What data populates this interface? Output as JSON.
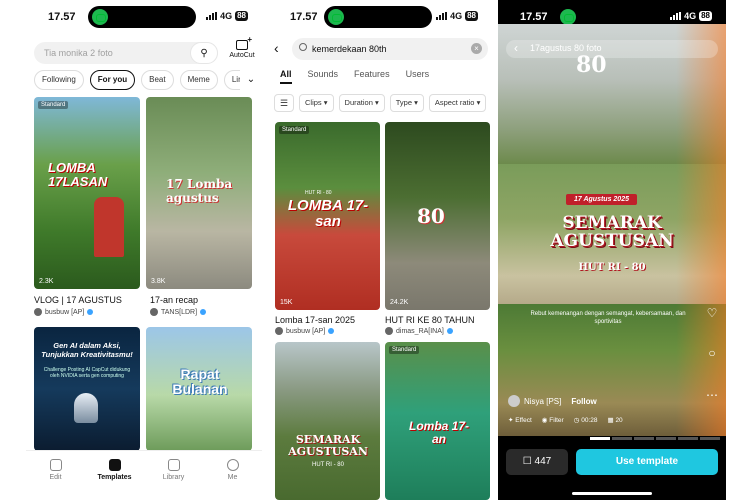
{
  "screen1": {
    "time": "17.57",
    "network": "4G",
    "battery": "88",
    "search_placeholder": "Tia monika 2 foto",
    "autocut_label": "AutoCut",
    "chips": [
      "Following",
      "For you",
      "Beat",
      "Meme",
      "Lirik V"
    ],
    "active_chip": "For you",
    "cards": [
      {
        "tag": "Standard",
        "likes": "2.3K",
        "title": "VLOG | 17 AGUSTUS",
        "author": "busbuw [AP]",
        "overlay": "LOMBA 17LASAN"
      },
      {
        "tag": "",
        "likes": "3.8K",
        "title": "17-an recap",
        "author": "TANS[LDR]",
        "overlay": "17 Lomba agustus"
      },
      {
        "tag": "",
        "likes": "",
        "title": "",
        "author": "",
        "overlay_head": "Gen AI dalam Aksi, Tunjukkan Kreativitasmu!",
        "overlay_sub": "Challenge Posting AI CapCut didukung oleh NVIDIA serta gen computing"
      },
      {
        "tag": "",
        "likes": "",
        "title": "",
        "author": "",
        "overlay": "Rapat Bulanan"
      }
    ],
    "tabs": [
      {
        "label": "Edit",
        "icon": "scissors-icon"
      },
      {
        "label": "Templates",
        "icon": "templates-icon"
      },
      {
        "label": "Library",
        "icon": "folder-icon"
      },
      {
        "label": "Me",
        "icon": "person-icon"
      }
    ]
  },
  "screen2": {
    "time": "17.57",
    "network": "4G",
    "battery": "88",
    "query": "kemerdekaan 80th",
    "tabs": [
      "All",
      "Sounds",
      "Features",
      "Users"
    ],
    "filters": [
      "Clips",
      "Duration",
      "Type",
      "Aspect ratio"
    ],
    "cards": [
      {
        "tag": "Standard",
        "likes": "15K",
        "title": "Lomba 17-san 2025",
        "author": "busbuw [AP]",
        "overlay": "LOMBA 17-san",
        "overlay_top": "HUT RI - 80"
      },
      {
        "tag": "",
        "likes": "24.2K",
        "title": "HUT RI KE 80 TAHUN",
        "author": "dimas_RA[INA]",
        "overlay": "80"
      },
      {
        "tag": "",
        "likes": "",
        "title": "",
        "author": "",
        "overlay": "SEMARAK AGUSTUSAN",
        "overlay_sub": "HUT RI - 80"
      },
      {
        "tag": "Standard",
        "likes": "",
        "title": "",
        "author": "",
        "overlay": "Lomba 17-an"
      }
    ]
  },
  "screen3": {
    "time": "17.57",
    "network": "4G",
    "battery": "88",
    "search_text": "17agustus 80 foto",
    "date_banner": "17 Agustus 2025",
    "headline": "SEMARAK AGUSTUSAN",
    "subline": "HUT RI - 80",
    "caption": "Rebut kemenangan dengan semangat, kebersamaan, dan sportivitas",
    "username": "Nisya [PS]",
    "follow": "Follow",
    "effect": "Effect",
    "filter": "Filter",
    "duration": "00:28",
    "clips": "20",
    "saves": "447",
    "use_template": "Use template"
  }
}
